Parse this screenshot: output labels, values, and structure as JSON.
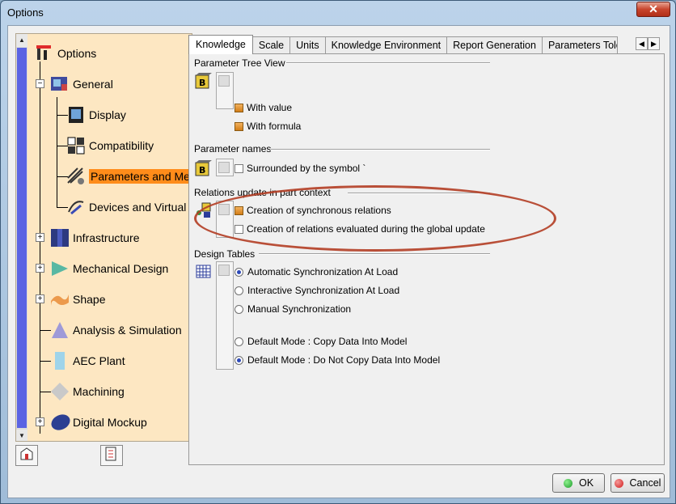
{
  "window": {
    "title": "Options",
    "close_glyph": "✕"
  },
  "tree": {
    "root": "Options",
    "items": [
      {
        "label": "General",
        "icon": "general-icon"
      },
      {
        "label": "Display",
        "icon": "display-icon"
      },
      {
        "label": "Compatibility",
        "icon": "compatibility-icon"
      },
      {
        "label": "Parameters and Mea",
        "icon": "parameters-icon",
        "selected": true
      },
      {
        "label": "Devices and Virtual F",
        "icon": "devices-icon"
      },
      {
        "label": "Infrastructure",
        "icon": "infrastructure-icon"
      },
      {
        "label": "Mechanical Design",
        "icon": "mechanical-design-icon"
      },
      {
        "label": "Shape",
        "icon": "shape-icon"
      },
      {
        "label": "Analysis & Simulation",
        "icon": "analysis-icon"
      },
      {
        "label": "AEC Plant",
        "icon": "aec-plant-icon"
      },
      {
        "label": "Machining",
        "icon": "machining-icon"
      },
      {
        "label": "Digital Mockup",
        "icon": "digital-mockup-icon"
      }
    ]
  },
  "tabs": [
    "Knowledge",
    "Scale",
    "Units",
    "Knowledge Environment",
    "Report Generation",
    "Parameters Toler"
  ],
  "groups": {
    "tree_view": {
      "title": "Parameter Tree View",
      "options": [
        "With value",
        "With formula"
      ]
    },
    "names": {
      "title": "Parameter names",
      "options": [
        "Surrounded by the symbol `"
      ]
    },
    "relations": {
      "title": "Relations update in part context",
      "options": [
        "Creation of synchronous relations",
        "Creation of relations evaluated during the global update"
      ]
    },
    "design_tables": {
      "title": "Design Tables",
      "options": [
        "Automatic Synchronization At Load",
        "Interactive Synchronization At Load",
        "Manual Synchronization",
        "Default Mode : Copy Data Into Model",
        "Default Mode : Do Not Copy Data Into Model"
      ]
    }
  },
  "buttons": {
    "ok": "OK",
    "cancel": "Cancel"
  },
  "colors": {
    "selection": "#ff8c1a",
    "ok_dot": "#1d9b2a",
    "cancel_dot": "#d11b1b",
    "highlight_ellipse": "#b23d24"
  }
}
